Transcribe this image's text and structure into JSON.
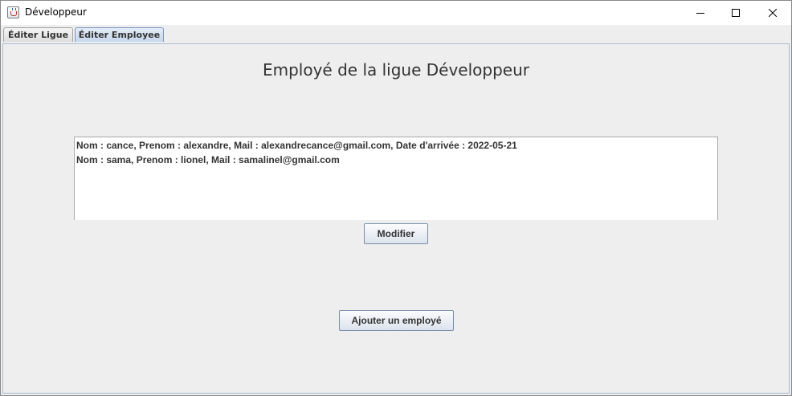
{
  "window": {
    "title": "Développeur",
    "icon": "java-cup-icon"
  },
  "tabs": [
    {
      "label": "Éditer Ligue",
      "selected": false
    },
    {
      "label": "Éditer Employee",
      "selected": true
    }
  ],
  "main": {
    "title": "Employé de la ligue Développeur",
    "employees": [
      "Nom : cance, Prenom : alexandre, Mail : alexandrecance@gmail.com, Date d'arrivée : 2022-05-21",
      "Nom : sama, Prenom : lionel, Mail : samalinel@gmail.com"
    ],
    "modify_button": "Modifier",
    "add_button": "Ajouter un employé"
  },
  "colors": {
    "background": "#eeeeee",
    "selected_tab": "#c6d7ec",
    "panel_border": "#a9bbd4"
  }
}
